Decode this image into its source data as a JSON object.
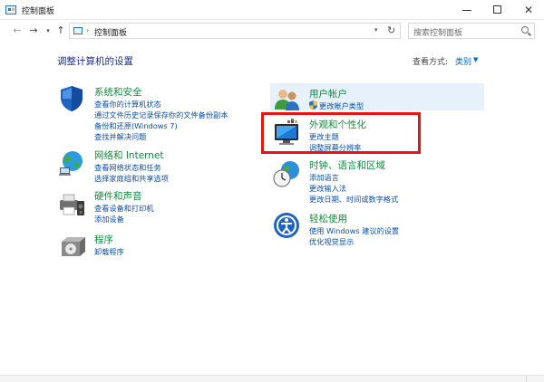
{
  "window": {
    "title": "控制面板",
    "colors": {
      "link": "#0b4ea8",
      "category": "#138a3c",
      "highlight": "#ee1111"
    }
  },
  "nav": {
    "address_path": "控制面板",
    "search_placeholder": "搜索控制面板",
    "icons": [
      "back-arrow-icon",
      "forward-arrow-icon",
      "recent-dropdown-icon",
      "up-arrow-icon",
      "refresh-icon",
      "search-icon"
    ]
  },
  "main": {
    "page_title": "调整计算机的设置",
    "view_by_label": "查看方式:",
    "view_by_value": "类别"
  },
  "categories_left": [
    {
      "title": "系统和安全",
      "icon": "shield-icon",
      "links": [
        "查看你的计算机状态",
        "通过文件历史记录保存你的文件备份副本",
        "备份和还原(Windows 7)",
        "查找并解决问题"
      ]
    },
    {
      "title": "网络和 Internet",
      "icon": "network-globe-icon",
      "links": [
        "查看网络状态和任务",
        "选择家庭组和共享选项"
      ]
    },
    {
      "title": "硬件和声音",
      "icon": "printer-speaker-icon",
      "links": [
        "查看设备和打印机",
        "添加设备"
      ]
    },
    {
      "title": "程序",
      "icon": "programs-disc-icon",
      "links": [
        "卸载程序"
      ]
    }
  ],
  "categories_right": [
    {
      "title": "用户帐户",
      "icon": "users-icon",
      "links": [
        "更改帐户类型"
      ],
      "link_icon": "uac-shield-icon"
    },
    {
      "title": "外观和个性化",
      "icon": "monitor-palette-icon",
      "links": [
        "更改主题",
        "调整屏幕分辨率"
      ]
    },
    {
      "title": "时钟、语言和区域",
      "icon": "clock-globe-icon",
      "links": [
        "添加语言",
        "更改输入法",
        "更改日期、时间或数字格式"
      ]
    },
    {
      "title": "轻松使用",
      "icon": "ease-of-access-icon",
      "links": [
        "使用 Windows 建议的设置",
        "优化视觉显示"
      ]
    }
  ]
}
